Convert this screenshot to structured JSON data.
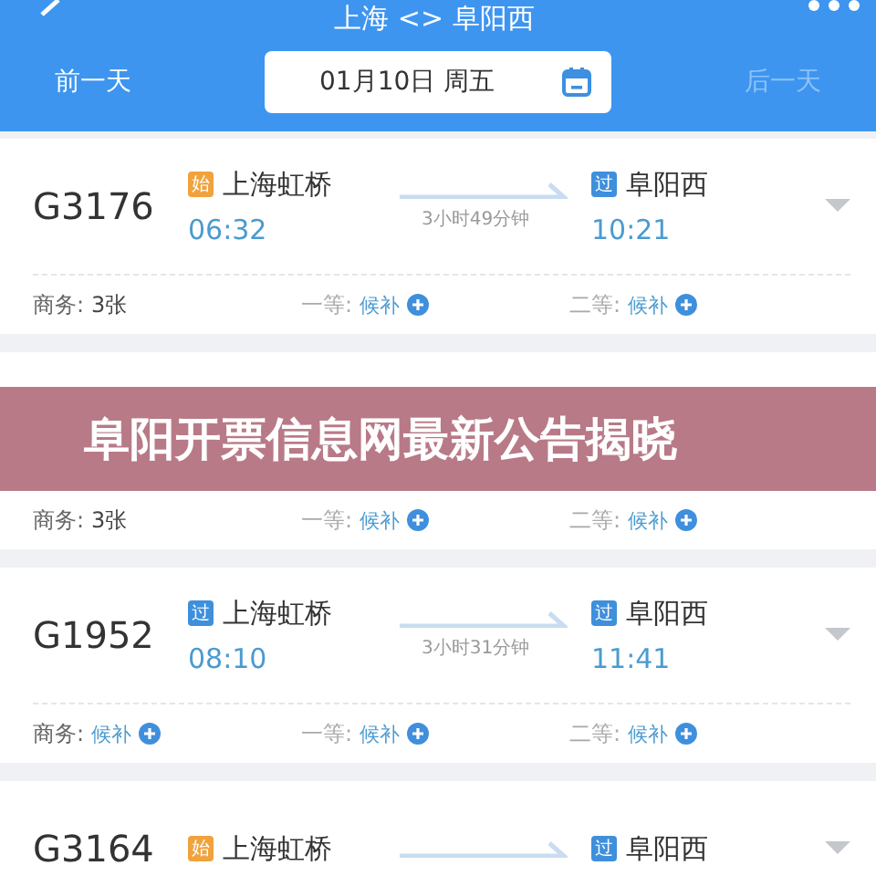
{
  "header": {
    "title": "上海 <> 阜阳西",
    "prev_day": {
      "label": "前一天",
      "disabled": false
    },
    "date": "01月10日 周五",
    "next_day": {
      "label": "后一天",
      "disabled": true
    }
  },
  "trains": [
    {
      "number": "G3176",
      "from": {
        "badge": "始",
        "color": "#f0a23c",
        "name": "上海虹桥",
        "time": "06:32"
      },
      "duration": "3小时49分钟",
      "to": {
        "badge": "过",
        "color": "#3f8fdc",
        "name": "阜阳西",
        "time": "10:21"
      },
      "seats": [
        {
          "label": "商务:",
          "value": "3张",
          "kind": "count"
        },
        {
          "label": "一等:",
          "value": "候补",
          "kind": "waitlist"
        },
        {
          "label": "二等:",
          "value": "候补",
          "kind": "waitlist"
        }
      ]
    },
    {
      "seats": [
        {
          "label": "商务:",
          "value": "3张",
          "kind": "count"
        },
        {
          "label": "一等:",
          "value": "候补",
          "kind": "waitlist"
        },
        {
          "label": "二等:",
          "value": "候补",
          "kind": "waitlist"
        }
      ]
    },
    {
      "number": "G1952",
      "from": {
        "badge": "过",
        "color": "#3f8fdc",
        "name": "上海虹桥",
        "time": "08:10"
      },
      "duration": "3小时31分钟",
      "to": {
        "badge": "过",
        "color": "#3f8fdc",
        "name": "阜阳西",
        "time": "11:41"
      },
      "seats": [
        {
          "label": "商务:",
          "value": "候补",
          "kind": "waitlist"
        },
        {
          "label": "一等:",
          "value": "候补",
          "kind": "waitlist"
        },
        {
          "label": "二等:",
          "value": "候补",
          "kind": "waitlist"
        }
      ]
    },
    {
      "number": "G3164",
      "from": {
        "badge": "始",
        "color": "#f0a23c",
        "name": "上海虹桥"
      },
      "to": {
        "badge": "过",
        "color": "#3f8fdc",
        "name": "阜阳西"
      }
    }
  ],
  "banner": {
    "text": "阜阳开票信息网最新公告揭晓"
  }
}
